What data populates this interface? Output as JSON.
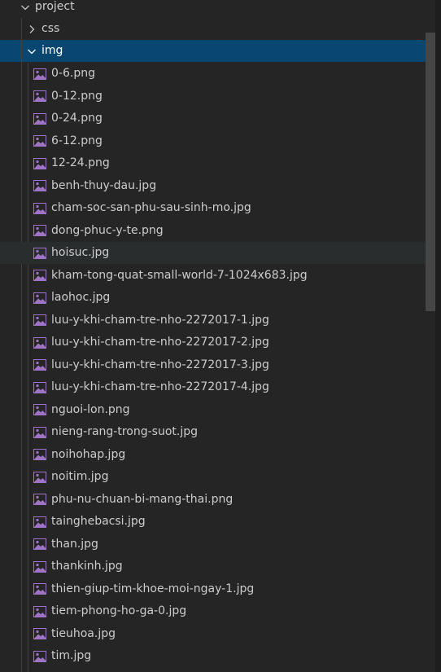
{
  "colors": {
    "background": "#252526",
    "selected_row": "#094771",
    "hover_row": "#2a2d2e",
    "text": "#cccccc",
    "image_icon": "#a074c4"
  },
  "tree": {
    "root": {
      "label": "project",
      "icon": "chevron-down-icon"
    },
    "css_folder": {
      "label": "css",
      "icon": "chevron-right-icon"
    },
    "img_folder": {
      "label": "img",
      "icon": "chevron-down-icon"
    },
    "files": [
      {
        "label": "0-6.png",
        "icon": "image-file-icon"
      },
      {
        "label": "0-12.png",
        "icon": "image-file-icon"
      },
      {
        "label": "0-24.png",
        "icon": "image-file-icon"
      },
      {
        "label": "6-12.png",
        "icon": "image-file-icon"
      },
      {
        "label": "12-24.png",
        "icon": "image-file-icon"
      },
      {
        "label": "benh-thuy-dau.jpg",
        "icon": "image-file-icon"
      },
      {
        "label": "cham-soc-san-phu-sau-sinh-mo.jpg",
        "icon": "image-file-icon"
      },
      {
        "label": "dong-phuc-y-te.png",
        "icon": "image-file-icon"
      },
      {
        "label": "hoisuc.jpg",
        "icon": "image-file-icon"
      },
      {
        "label": "kham-tong-quat-small-world-7-1024x683.jpg",
        "icon": "image-file-icon"
      },
      {
        "label": "laohoc.jpg",
        "icon": "image-file-icon"
      },
      {
        "label": "luu-y-khi-cham-tre-nho-2272017-1.jpg",
        "icon": "image-file-icon"
      },
      {
        "label": "luu-y-khi-cham-tre-nho-2272017-2.jpg",
        "icon": "image-file-icon"
      },
      {
        "label": "luu-y-khi-cham-tre-nho-2272017-3.jpg",
        "icon": "image-file-icon"
      },
      {
        "label": "luu-y-khi-cham-tre-nho-2272017-4.jpg",
        "icon": "image-file-icon"
      },
      {
        "label": "nguoi-lon.png",
        "icon": "image-file-icon"
      },
      {
        "label": "nieng-rang-trong-suot.jpg",
        "icon": "image-file-icon"
      },
      {
        "label": "noihohap.jpg",
        "icon": "image-file-icon"
      },
      {
        "label": "noitim.jpg",
        "icon": "image-file-icon"
      },
      {
        "label": "phu-nu-chuan-bi-mang-thai.png",
        "icon": "image-file-icon"
      },
      {
        "label": "tainghebacsi.jpg",
        "icon": "image-file-icon"
      },
      {
        "label": "than.jpg",
        "icon": "image-file-icon"
      },
      {
        "label": "thankinh.jpg",
        "icon": "image-file-icon"
      },
      {
        "label": "thien-giup-tim-khoe-moi-ngay-1.jpg",
        "icon": "image-file-icon"
      },
      {
        "label": "tiem-phong-ho-ga-0.jpg",
        "icon": "image-file-icon"
      },
      {
        "label": "tieuhoa.jpg",
        "icon": "image-file-icon"
      },
      {
        "label": "tim.jpg",
        "icon": "image-file-icon"
      }
    ]
  }
}
